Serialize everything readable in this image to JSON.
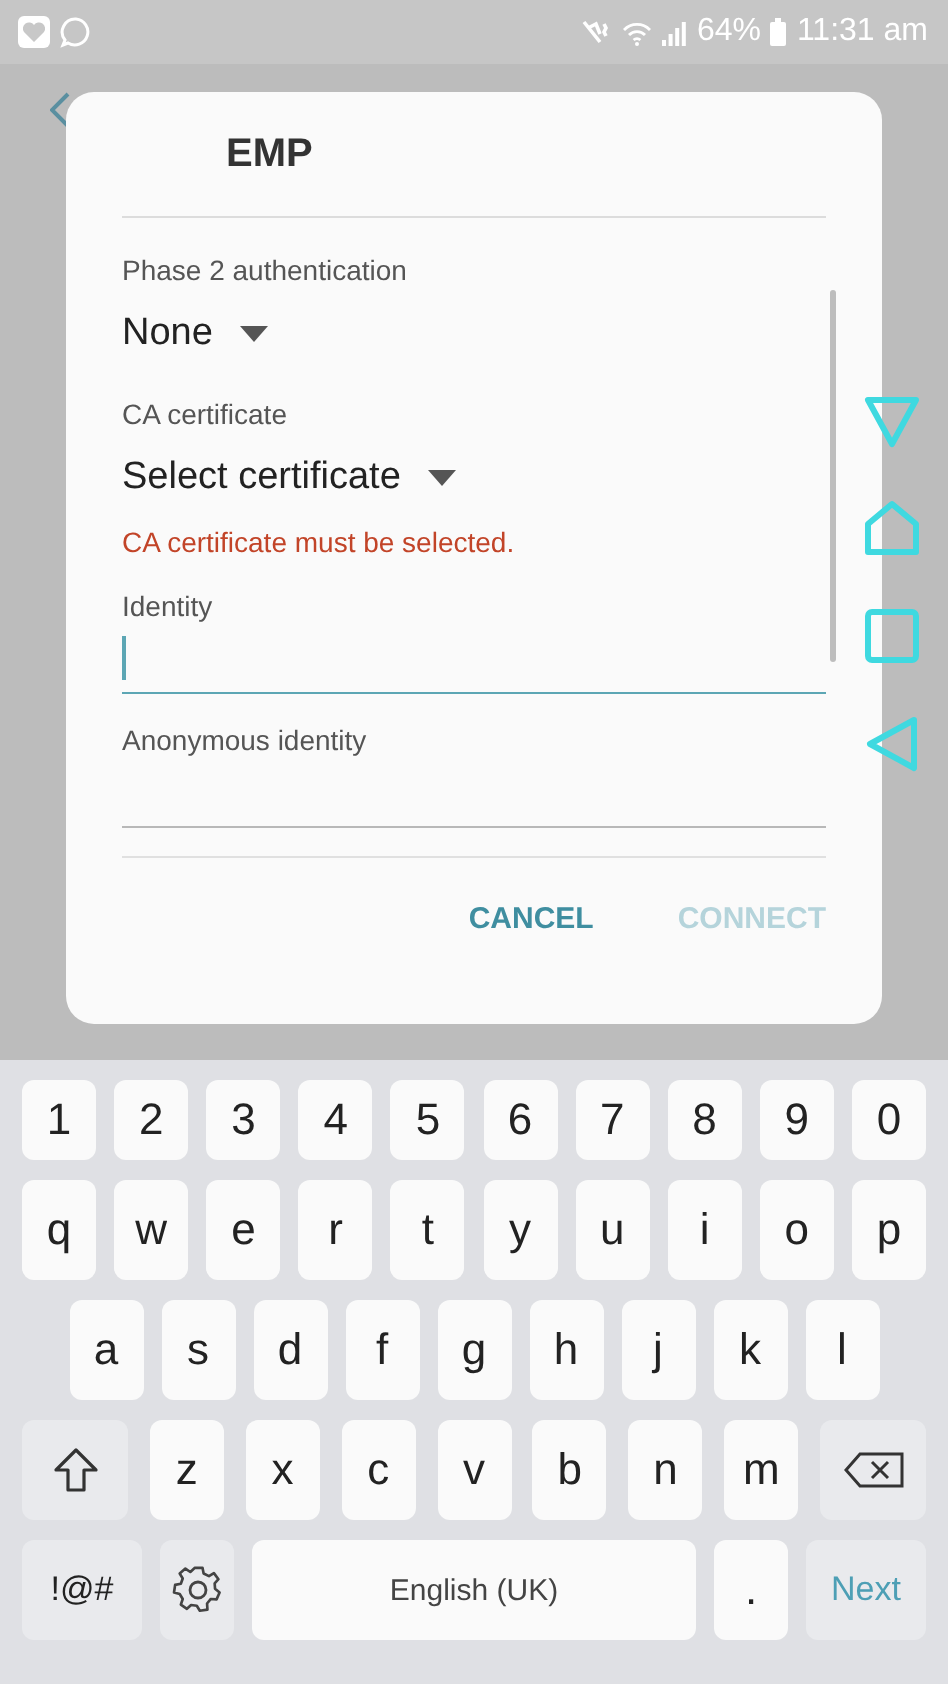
{
  "status_bar": {
    "battery": "64%",
    "time": "11:31 am"
  },
  "dialog": {
    "title": "EMP",
    "fields": [
      {
        "kind": "dropdown",
        "label": "Phase 2 authentication",
        "value": "None"
      },
      {
        "kind": "dropdown",
        "label": "CA certificate",
        "value": "Select certificate",
        "error": "CA certificate must be selected."
      },
      {
        "kind": "input",
        "label": "Identity",
        "focused": true
      },
      {
        "kind": "input",
        "label": "Anonymous identity",
        "focused": false
      }
    ],
    "buttons": [
      {
        "label": "CANCEL",
        "disabled": false
      },
      {
        "label": "CONNECT",
        "disabled": true
      }
    ]
  },
  "keyboard": {
    "number_row": {
      "keys": [
        {
          "kind": "char",
          "label": "1"
        },
        {
          "kind": "char",
          "label": "2"
        },
        {
          "kind": "char",
          "label": "3"
        },
        {
          "kind": "char",
          "label": "4"
        },
        {
          "kind": "char",
          "label": "5"
        },
        {
          "kind": "char",
          "label": "6"
        },
        {
          "kind": "char",
          "label": "7"
        },
        {
          "kind": "char",
          "label": "8"
        },
        {
          "kind": "char",
          "label": "9"
        },
        {
          "kind": "char",
          "label": "0"
        }
      ]
    },
    "top_letter_row": {
      "keys": [
        {
          "kind": "char",
          "label": "q"
        },
        {
          "kind": "char",
          "label": "w"
        },
        {
          "kind": "char",
          "label": "e"
        },
        {
          "kind": "char",
          "label": "r"
        },
        {
          "kind": "char",
          "label": "t"
        },
        {
          "kind": "char",
          "label": "y"
        },
        {
          "kind": "char",
          "label": "u"
        },
        {
          "kind": "char",
          "label": "i"
        },
        {
          "kind": "char",
          "label": "o"
        },
        {
          "kind": "char",
          "label": "p"
        }
      ]
    },
    "middle_letter_row": {
      "keys": [
        {
          "kind": "char",
          "label": "a"
        },
        {
          "kind": "char",
          "label": "s"
        },
        {
          "kind": "char",
          "label": "d"
        },
        {
          "kind": "char",
          "label": "f"
        },
        {
          "kind": "char",
          "label": "g"
        },
        {
          "kind": "char",
          "label": "h"
        },
        {
          "kind": "char",
          "label": "j"
        },
        {
          "kind": "char",
          "label": "k"
        },
        {
          "kind": "char",
          "label": "l"
        }
      ]
    },
    "bottom_letter_row": {
      "keys": [
        {
          "kind": "shift"
        },
        {
          "kind": "char",
          "label": "z"
        },
        {
          "kind": "char",
          "label": "x"
        },
        {
          "kind": "char",
          "label": "c"
        },
        {
          "kind": "char",
          "label": "v"
        },
        {
          "kind": "char",
          "label": "b"
        },
        {
          "kind": "char",
          "label": "n"
        },
        {
          "kind": "char",
          "label": "m"
        },
        {
          "kind": "backspace"
        }
      ]
    },
    "function_row": {
      "keys": [
        {
          "kind": "symbols",
          "label": "!@#"
        },
        {
          "kind": "settings"
        },
        {
          "kind": "space",
          "label": "English (UK)"
        },
        {
          "kind": "char",
          "label": "."
        },
        {
          "kind": "next",
          "label": "Next"
        }
      ]
    }
  }
}
